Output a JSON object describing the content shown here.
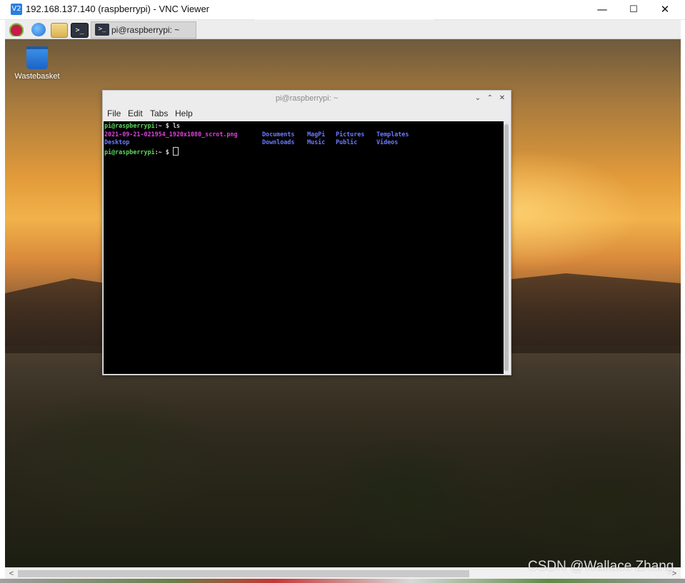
{
  "window": {
    "logo": "V2",
    "title": "192.168.137.140 (raspberrypi) - VNC Viewer",
    "minimize": "—",
    "maximize": "☐",
    "close": "✕"
  },
  "panel": {
    "icons": [
      "raspberry-menu-icon",
      "web-browser-icon",
      "file-manager-icon",
      "terminal-icon"
    ],
    "terminal_glyph": ">_",
    "task_label": "pi@raspberrypi: ~"
  },
  "desktop": {
    "wastebasket_label": "Wastebasket"
  },
  "terminal": {
    "title": "pi@raspberrypi: ~",
    "controls": {
      "minimize": "⌄",
      "maximize": "⌃",
      "close": "✕"
    },
    "menu": {
      "file": "File",
      "edit": "Edit",
      "tabs": "Tabs",
      "help": "Help"
    },
    "prompt": "pi@raspberrypi",
    "path": ":~ $ ",
    "command": "ls",
    "files": {
      "screenshot": "2021-09-21-021954_1920x1080_scrot.png",
      "desktop": "Desktop"
    },
    "dirs": {
      "documents": "Documents",
      "downloads": "Downloads",
      "magpi": "MagPi",
      "music": "Music",
      "pictures": "Pictures",
      "public": "Public",
      "templates": "Templates",
      "videos": "Videos"
    }
  },
  "scrollbar": {
    "left": "<",
    "right": ">"
  },
  "watermark": "CSDN @Wallace Zhang"
}
